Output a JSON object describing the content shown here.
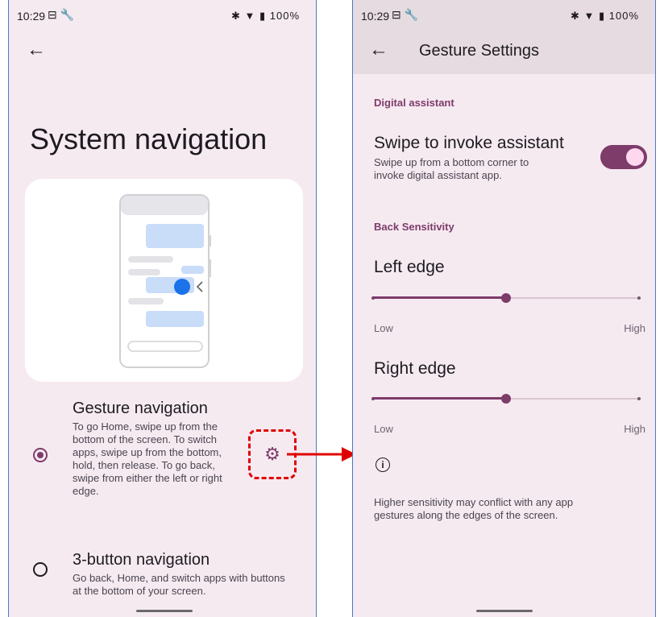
{
  "colors": {
    "accent": "#7d3c6a",
    "phone_bg": "#f6eaf1",
    "annotation_red": "#e00000"
  },
  "left_screen": {
    "status": {
      "time": "10:29",
      "battery": "100%"
    },
    "title": "System navigation",
    "options": [
      {
        "title": "Gesture navigation",
        "description": "To go Home, swipe up from the bottom of the screen. To switch apps, swipe up from the bottom, hold, then release. To go back, swipe from either the left or right edge.",
        "selected": true
      },
      {
        "title": "3-button navigation",
        "description": "Go back, Home, and switch apps with buttons at the bottom of your screen.",
        "selected": false
      }
    ]
  },
  "right_screen": {
    "status": {
      "time": "10:29",
      "battery": "100%"
    },
    "title": "Gesture Settings",
    "digital_assistant": {
      "section": "Digital assistant",
      "title": "Swipe to invoke assistant",
      "description": "Swipe up from a bottom corner to invoke digital assistant app.",
      "enabled": true
    },
    "back_sensitivity": {
      "section": "Back Sensitivity",
      "left_edge": {
        "label": "Left edge",
        "low": "Low",
        "high": "High",
        "value": 0.5
      },
      "right_edge": {
        "label": "Right edge",
        "low": "Low",
        "high": "High",
        "value": 0.5
      }
    },
    "info_text": "Higher sensitivity may conflict with any app gestures along the edges of the screen."
  }
}
